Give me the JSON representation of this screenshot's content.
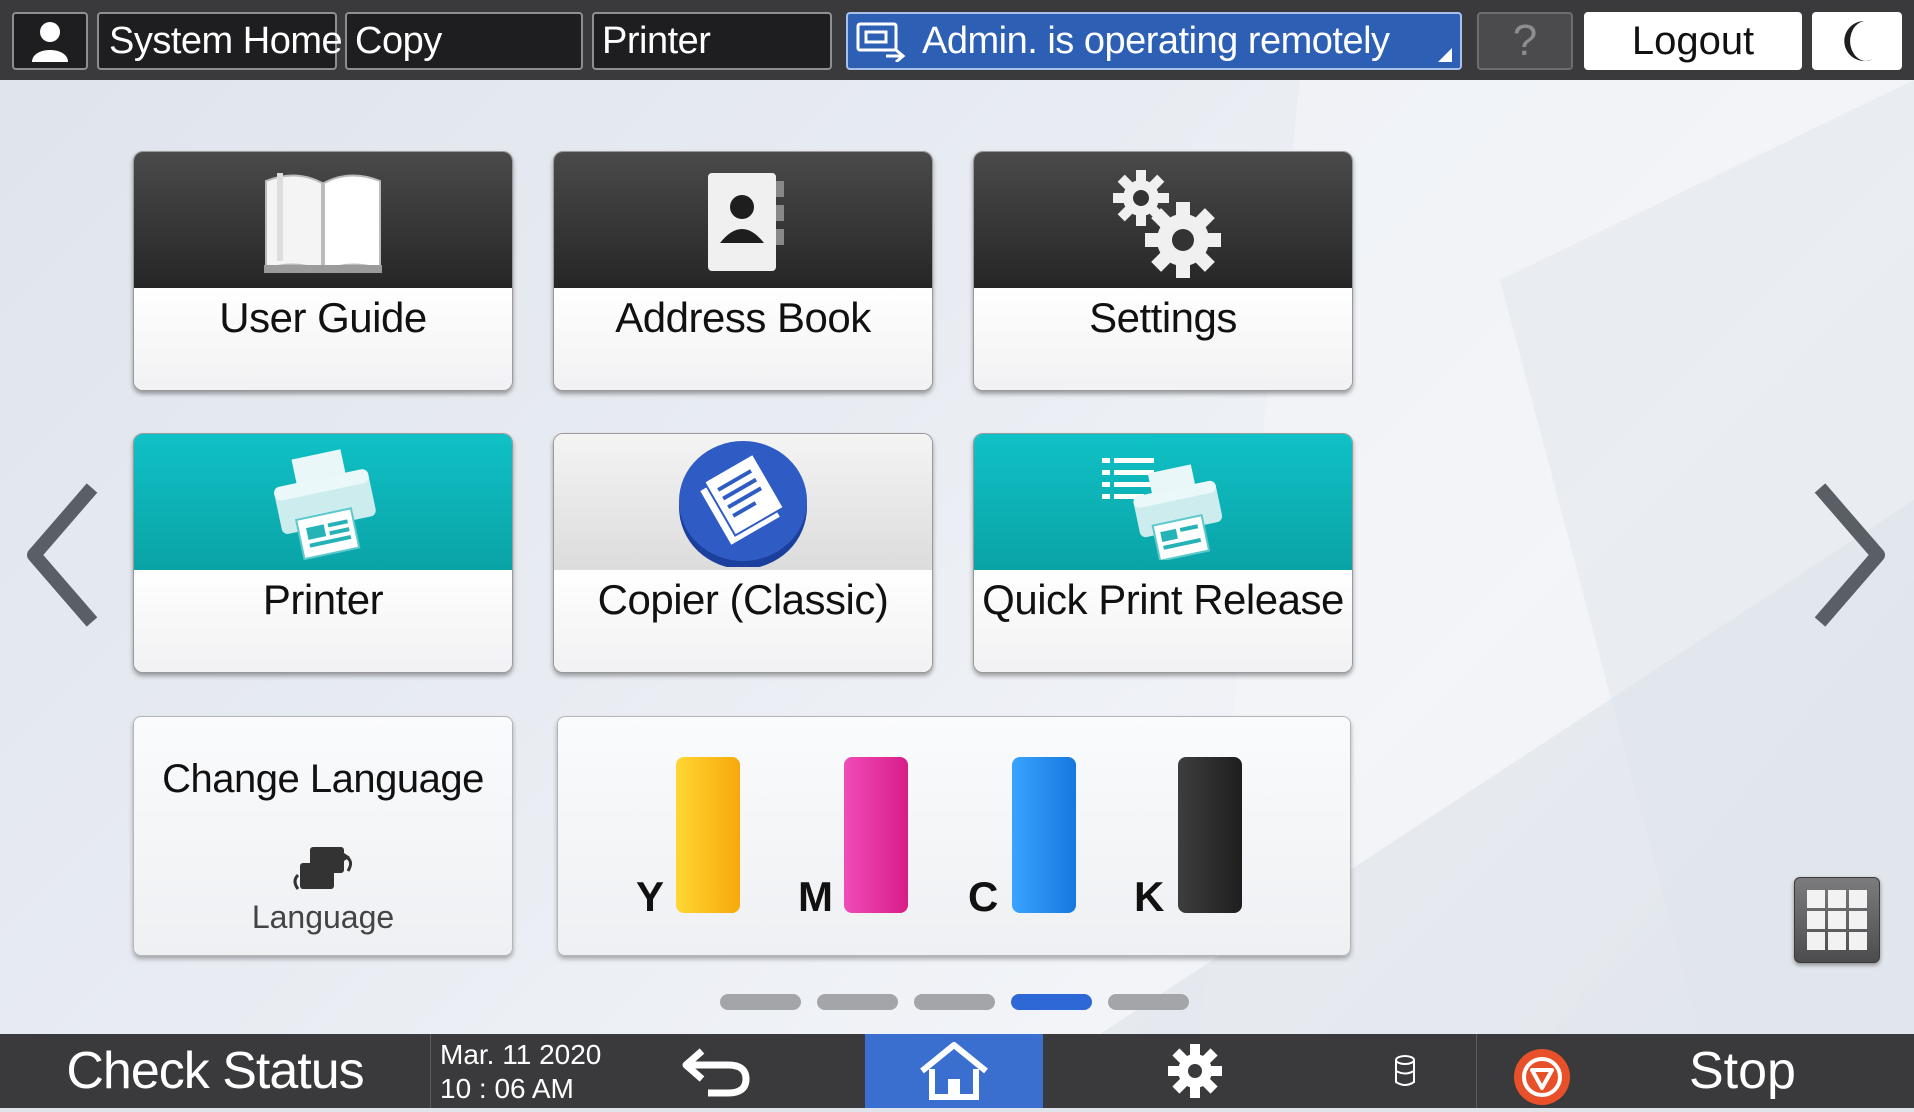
{
  "topbar": {
    "system_home": "System Home",
    "copy": "Copy",
    "printer": "Printer",
    "remote_status": "Admin. is operating remotely",
    "help": "?",
    "logout": "Logout"
  },
  "tiles": [
    {
      "label": "User Guide",
      "icon": "book-icon"
    },
    {
      "label": "Address Book",
      "icon": "address-book-icon"
    },
    {
      "label": "Settings",
      "icon": "gears-icon"
    },
    {
      "label": "Printer",
      "icon": "printer-icon"
    },
    {
      "label": "Copier (Classic)",
      "icon": "copier-icon"
    },
    {
      "label": "Quick Print Release",
      "icon": "quick-print-icon"
    }
  ],
  "language_widget": {
    "title": "Change Language",
    "label": "Language"
  },
  "toner": [
    {
      "letter": "Y",
      "color": "#f6b913"
    },
    {
      "letter": "M",
      "color": "#e62a9c"
    },
    {
      "letter": "C",
      "color": "#1e8ef0"
    },
    {
      "letter": "K",
      "color": "#2e2e2e"
    }
  ],
  "pagination": {
    "pages": 5,
    "current": 4
  },
  "bottombar": {
    "check_status": "Check Status",
    "date": "Mar. 11 2020",
    "time": "10 : 06 AM",
    "stop": "Stop"
  },
  "colors": {
    "topbar_bg": "#3a3a3c",
    "remote_blue": "#2d5fb5",
    "teal": "#0fc1c6",
    "home_active": "#3a6fd0",
    "stop_red": "#e8502a"
  }
}
